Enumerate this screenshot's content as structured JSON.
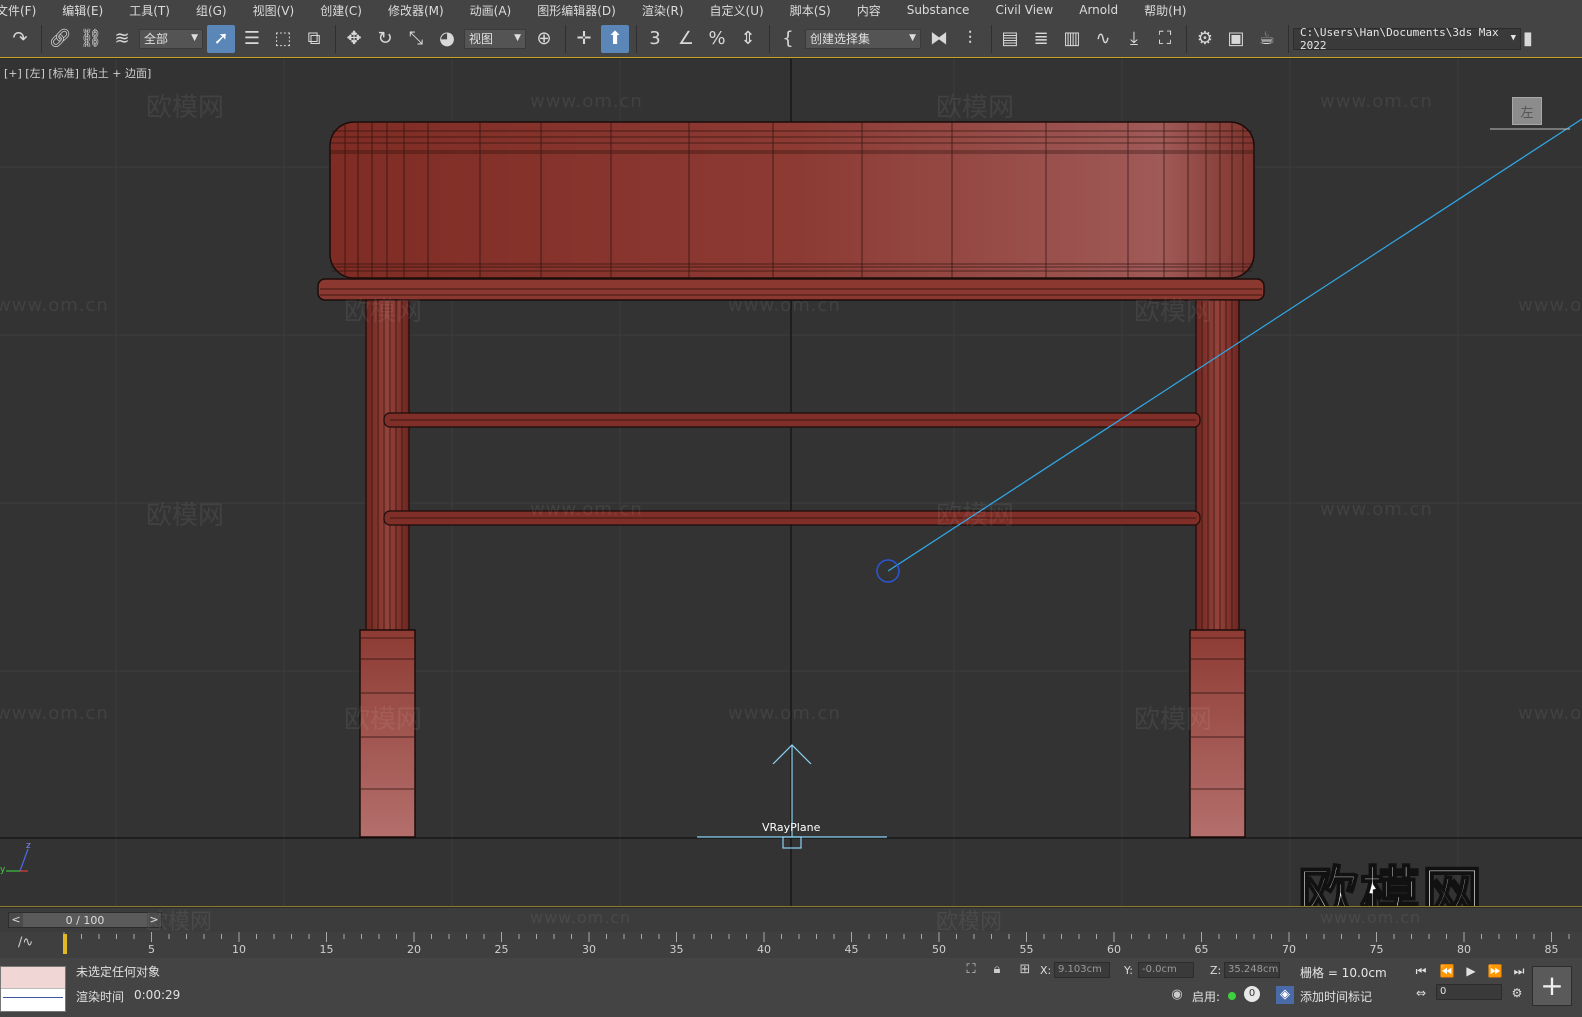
{
  "menu": [
    "文件(F)",
    "编辑(E)",
    "工具(T)",
    "组(G)",
    "视图(V)",
    "创建(C)",
    "修改器(M)",
    "动画(A)",
    "图形编辑器(D)",
    "渲染(R)",
    "自定义(U)",
    "脚本(S)",
    "内容",
    "Substance",
    "Civil View",
    "Arnold",
    "帮助(H)"
  ],
  "toolbar": {
    "selection_filter": "全部",
    "ref_coord": "视图",
    "named_selection_placeholder": "创建选择集",
    "project_path": "C:\\Users\\Han\\Documents\\3ds Max 2022"
  },
  "viewport": {
    "label": "[+] [左] [标准] [粘土 + 边面]",
    "object_label": "VRayPlane",
    "viewcube_face": "左",
    "watermark_text": "欧模网",
    "watermark_url": "www.om.cn",
    "brand_watermark": "欧模网",
    "axis_labels": {
      "z": "z",
      "y": "y"
    },
    "model_color": "#8f3a31",
    "background_color": "#333333",
    "grid_color": "#3f3f3f",
    "light_line_color": "#2fa9e8"
  },
  "timeline": {
    "frame_display": "0 / 100",
    "prev": "<",
    "next": ">",
    "ticks": [
      "5",
      "10",
      "15",
      "20",
      "25",
      "30",
      "35",
      "40",
      "45",
      "50",
      "55",
      "60",
      "65",
      "70",
      "75",
      "80",
      "85"
    ]
  },
  "status": {
    "selection_text": "未选定任何对象",
    "render_time_label": "渲染时间",
    "render_time_value": "0:00:29",
    "x_label": "X:",
    "x_value": "9.103cm",
    "y_label": "Y:",
    "y_value": "-0.0cm",
    "z_label": "Z:",
    "z_value": "35.248cm",
    "grid_label": "栅格 = 10.0cm",
    "enable_label": "启用:",
    "enable_count": "0",
    "add_time_tag": "添加时间标记",
    "current_frame": "0"
  }
}
